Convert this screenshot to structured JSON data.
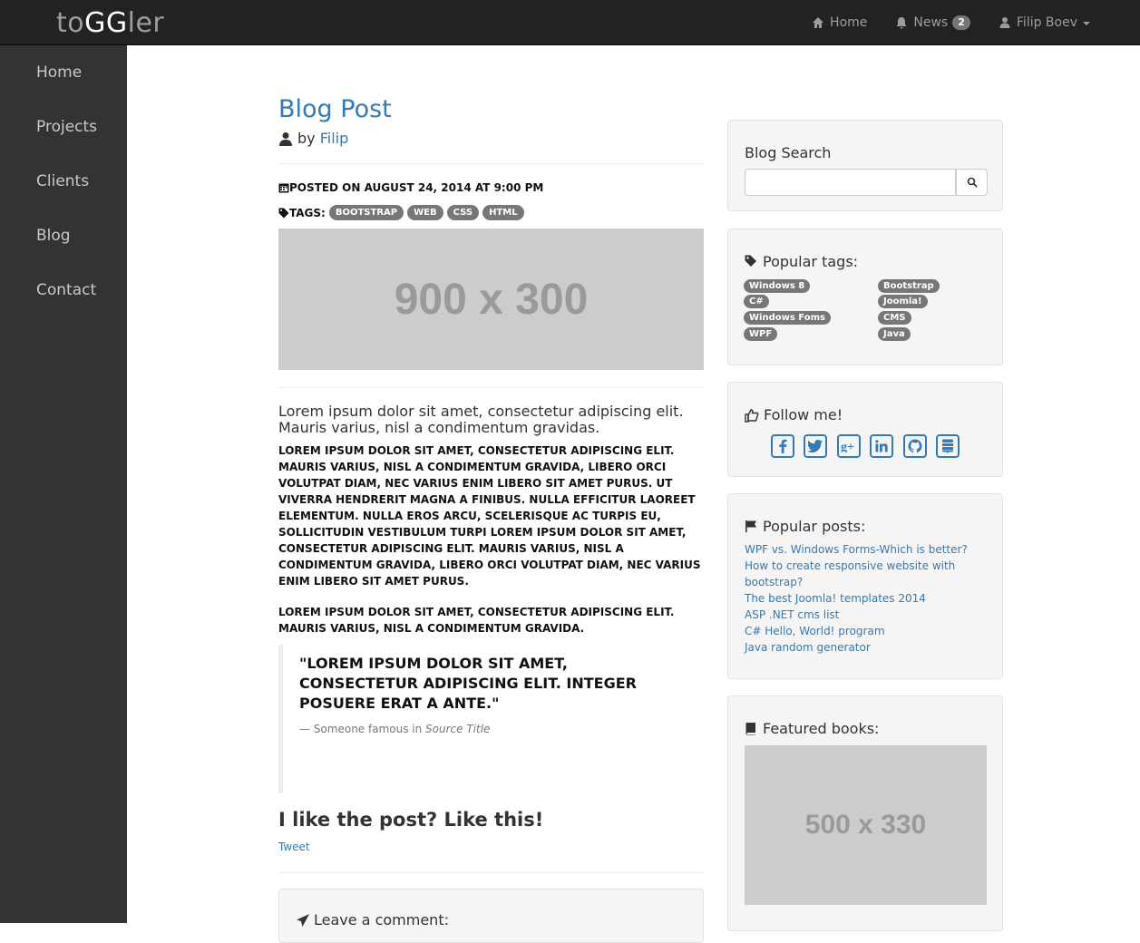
{
  "navbar": {
    "brand_part1": "to",
    "brand_part2": "GG",
    "brand_part3": "ler",
    "home_label": "Home",
    "news_label": "News",
    "news_count": "2",
    "user_label": "Filip Boev"
  },
  "sidebar": {
    "items": [
      {
        "label": "Home"
      },
      {
        "label": "Projects"
      },
      {
        "label": "Clients"
      },
      {
        "label": "Blog"
      },
      {
        "label": "Contact"
      }
    ]
  },
  "post": {
    "title": "Blog Post",
    "by": "by",
    "author": "Filip",
    "posted": "POSTED ON AUGUST 24, 2014 AT 9:00 PM",
    "tags_label": "TAGS:",
    "tags": [
      "BOOTSTRAP",
      "WEB",
      "CSS",
      "HTML"
    ],
    "image_label": "900 x 300",
    "lead": "Lorem ipsum dolor sit amet, consectetur adipiscing elit. Mauris varius, nisl a condimentum gravidas.",
    "paragraph1": "Lorem ipsum dolor sit amet, consectetur adipiscing elit. Mauris varius, nisl a condimentum gravida, libero orci volutpat diam, nec varius enim libero sit amet purus. Ut viverra hendrerit magna a finibus. Nulla efficitur laoreet elementum. Nulla eros arcu, scelerisque ac turpis eu, sollicitudin vestibulum turpi lorem ipsum dolor sit amet, consectetur adipiscing elit. Mauris varius, nisl a condimentum gravida, libero orci volutpat diam, nec varius enim libero sit amet purus.",
    "paragraph2": "Lorem ipsum dolor sit amet, consectetur adipiscing elit. Mauris varius, nisl a condimentum gravida.",
    "quote": "\"Lorem ipsum dolor sit amet, consectetur adipiscing elit. Integer posuere erat a ante.\"",
    "quote_source_prefix": "— Someone famous in",
    "quote_source_title": "Source Title",
    "like_heading": "I like the post? Like this!",
    "tweet_label": "Tweet",
    "comment_heading": "Leave a comment:"
  },
  "sidebar_widgets": {
    "search_title": "Blog Search",
    "search_placeholder": "",
    "tags_title": "Popular tags:",
    "tags_col1": [
      "Windows 8",
      "C#",
      "Windows Foms",
      "WPF"
    ],
    "tags_col2": [
      "Bootstrap",
      "Joomla!",
      "CMS",
      "Java"
    ],
    "follow_title": "Follow me!",
    "social_icons": [
      "facebook-icon",
      "twitter-icon",
      "google-plus-icon",
      "linkedin-icon",
      "github-icon",
      "stack-exchange-icon"
    ],
    "popular_title": "Popular posts:",
    "popular_posts": [
      "WPF vs. Windows Forms-Which is better?",
      "How to create responsive website with bootstrap?",
      "The best Joomla! templates 2014",
      "ASP .NET cms list",
      "C# Hello, World! program",
      "Java random generator"
    ],
    "books_title": "Featured books:",
    "books_image_label": "500 x 330"
  },
  "colors": {
    "navbar_bg": "#222222",
    "sidebar_bg": "#333333",
    "link": "#337ab7",
    "badge": "#777777",
    "placeholder_bg": "#cccccc"
  }
}
